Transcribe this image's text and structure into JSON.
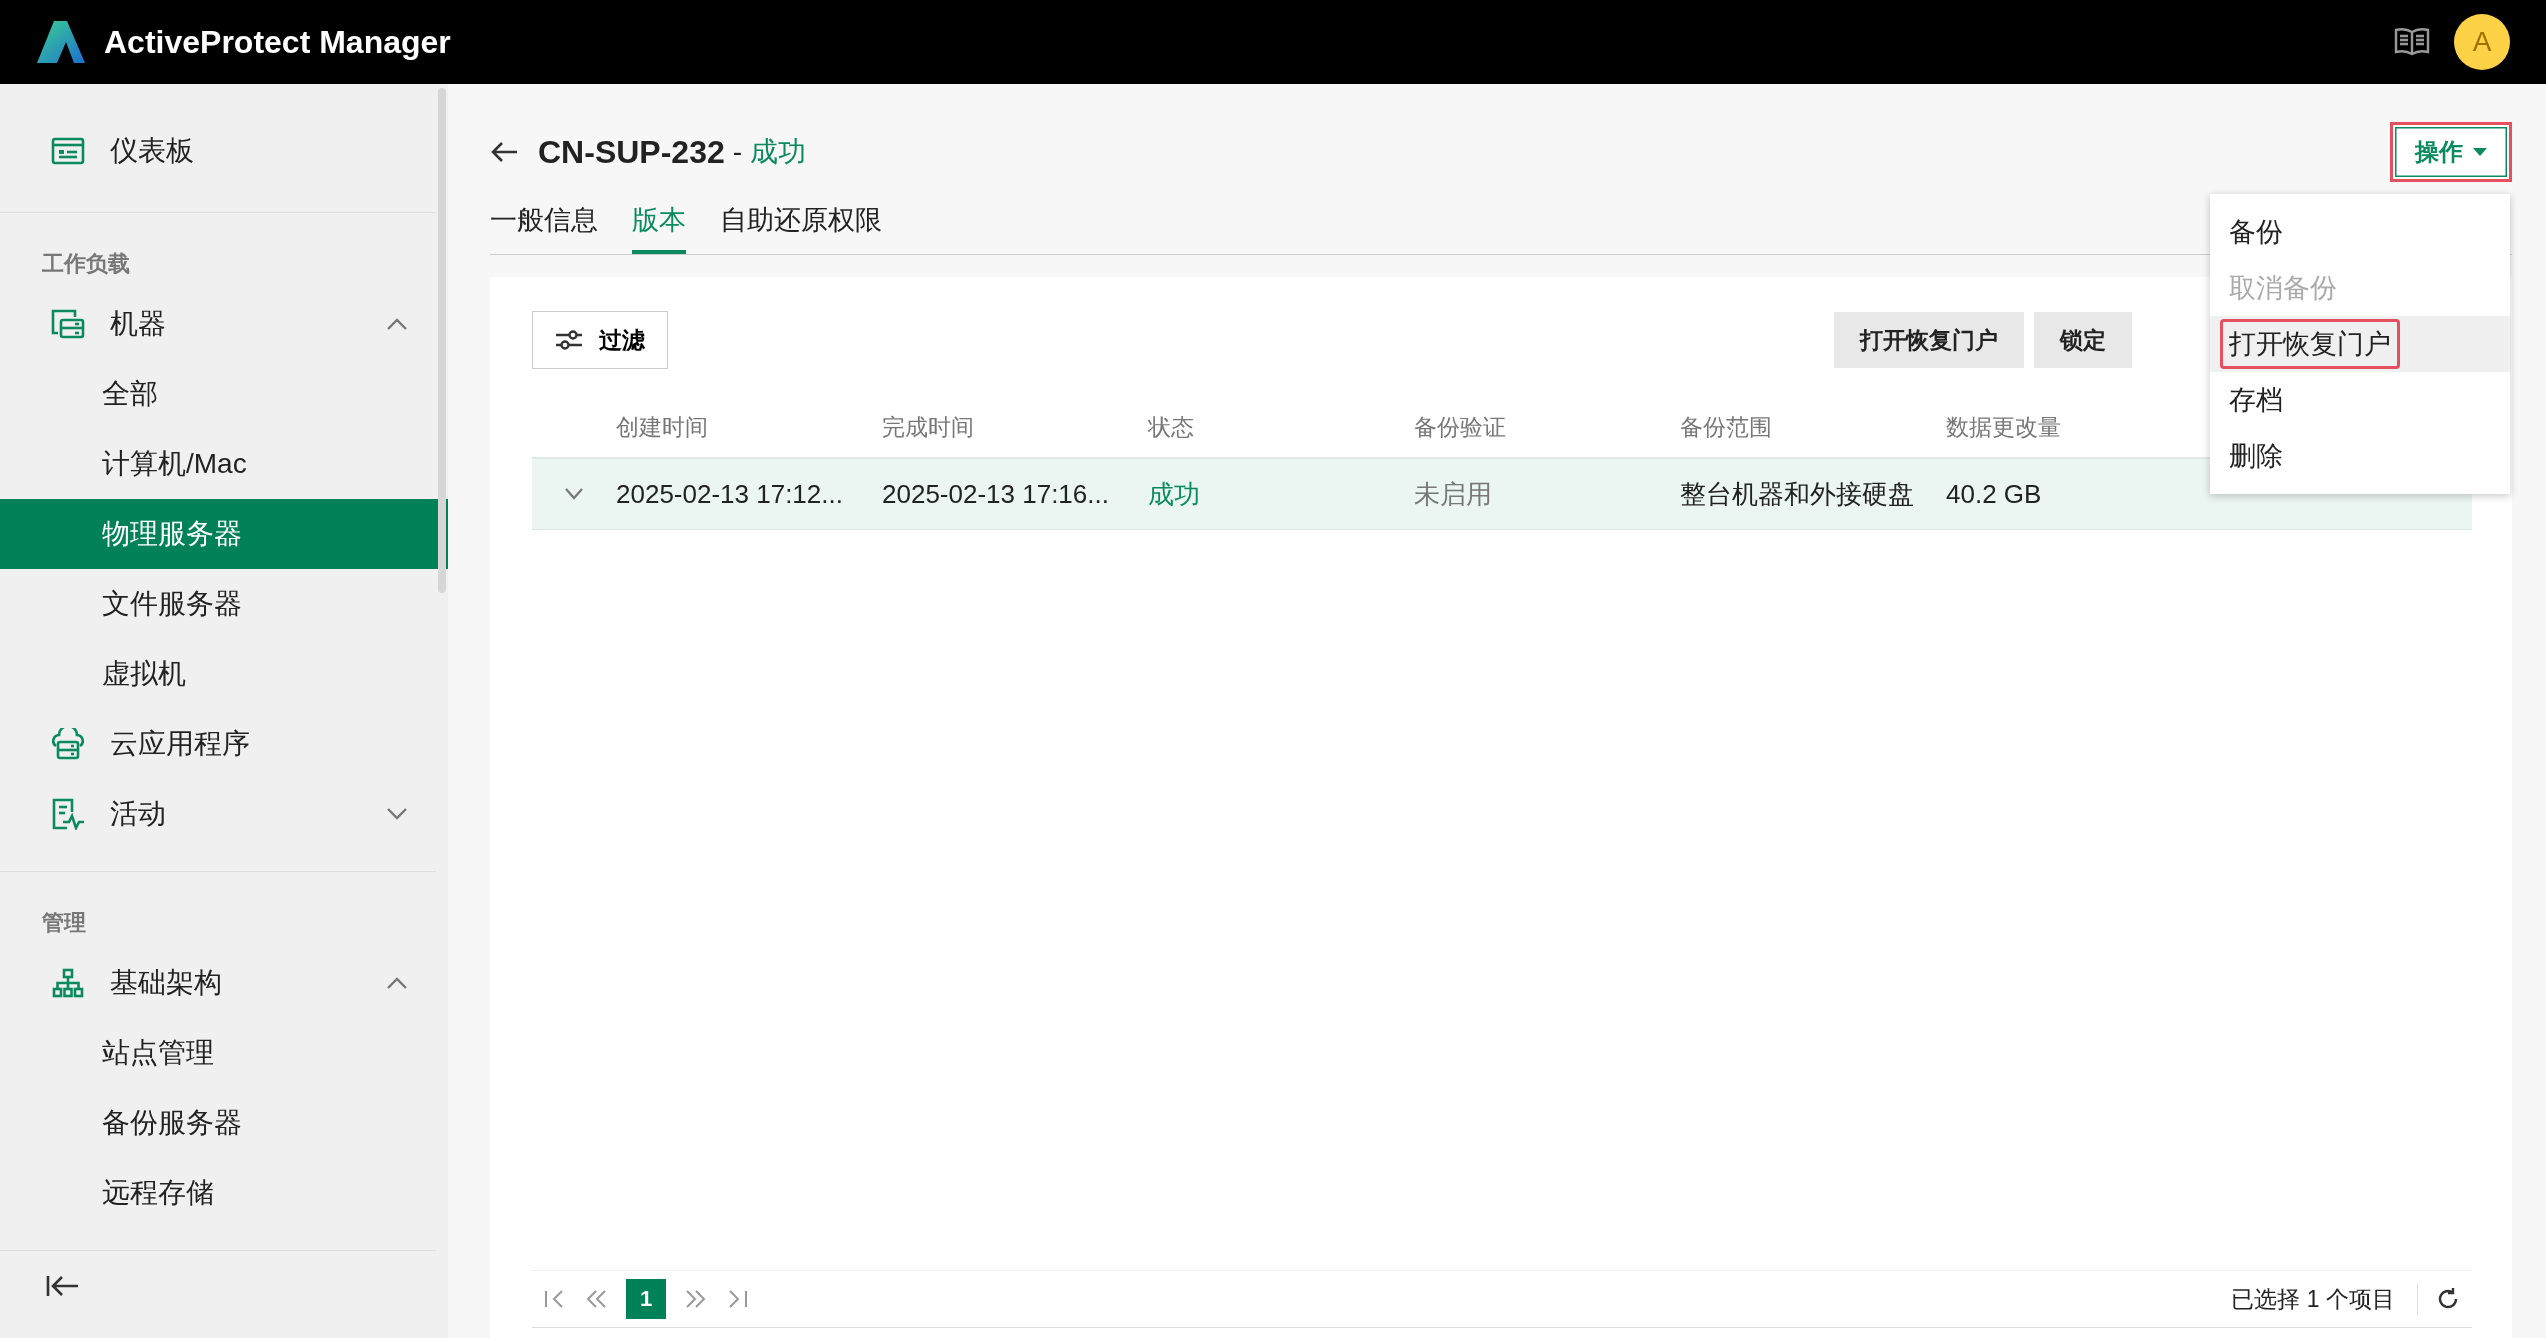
{
  "header": {
    "title": "ActiveProtect Manager",
    "avatar": "A"
  },
  "sidebar": {
    "top_items": [
      {
        "label": "仪表板",
        "selected": false
      }
    ],
    "sections": [
      {
        "heading": "工作负载",
        "items": [
          {
            "label": "机器",
            "selected": false,
            "expanded": true,
            "children": [
              {
                "label": "全部",
                "selected": false
              },
              {
                "label": "计算机/Mac",
                "selected": false
              },
              {
                "label": "物理服务器",
                "selected": true
              },
              {
                "label": "文件服务器",
                "selected": false
              },
              {
                "label": "虚拟机",
                "selected": false
              }
            ]
          },
          {
            "label": "云应用程序",
            "selected": false
          },
          {
            "label": "活动",
            "selected": false,
            "expanded": false
          }
        ]
      },
      {
        "heading": "管理",
        "items": [
          {
            "label": "基础架构",
            "selected": false,
            "expanded": true,
            "children": [
              {
                "label": "站点管理",
                "selected": false
              },
              {
                "label": "备份服务器",
                "selected": false
              },
              {
                "label": "远程存储",
                "selected": false
              }
            ]
          }
        ]
      }
    ]
  },
  "page": {
    "title": "CN-SUP-232",
    "separator": "-",
    "status": "成功"
  },
  "actions": {
    "label": "操作",
    "highlighted": true,
    "menu": [
      {
        "label": "备份",
        "disabled": false,
        "hovered": false,
        "highlighted": false
      },
      {
        "label": "取消备份",
        "disabled": true,
        "hovered": false,
        "highlighted": false
      },
      {
        "label": "打开恢复门户",
        "disabled": false,
        "hovered": true,
        "highlighted": true
      },
      {
        "label": "存档",
        "disabled": false,
        "hovered": false,
        "highlighted": false
      },
      {
        "label": "删除",
        "disabled": false,
        "hovered": false,
        "highlighted": false
      }
    ]
  },
  "tabs": [
    {
      "label": "一般信息",
      "selected": false
    },
    {
      "label": "版本",
      "selected": true
    },
    {
      "label": "自助还原权限",
      "selected": false
    }
  ],
  "toolbar": {
    "filter": "过滤",
    "buttons": [
      "打开恢复门户",
      "锁定"
    ]
  },
  "table": {
    "columns": [
      "创建时间",
      "完成时间",
      "状态",
      "备份验证",
      "备份范围",
      "数据更改量"
    ],
    "rows": [
      {
        "selected": true,
        "expanded": false,
        "created": "2025-02-13 17:12...",
        "finished": "2025-02-13 17:16...",
        "status": "成功",
        "verification": "未启用",
        "scope": "整台机器和外接硬盘",
        "change": "40.2 GB"
      }
    ]
  },
  "pagination": {
    "pages": [
      {
        "label": "1",
        "selected": true
      }
    ],
    "summary": "已选择 1 个项目"
  }
}
